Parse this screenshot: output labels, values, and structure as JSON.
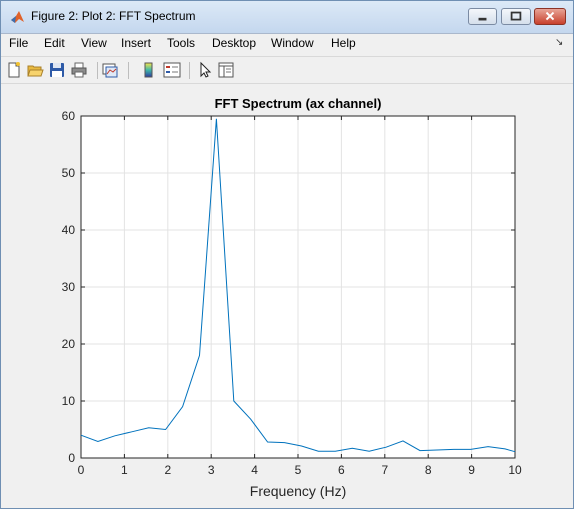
{
  "window": {
    "title": "Figure 2: Plot 2: FFT Spectrum"
  },
  "menu": {
    "items": [
      "File",
      "Edit",
      "View",
      "Insert",
      "Tools",
      "Desktop",
      "Window",
      "Help"
    ],
    "overflow_icon": "dock-arrow-icon"
  },
  "toolbar": {
    "icons": [
      "new-figure-icon",
      "open-file-icon",
      "save-icon",
      "print-icon",
      "link-plot-icon",
      "insert-colorbar-icon",
      "insert-legend-icon",
      "edit-plot-arrow-icon",
      "property-inspector-icon"
    ]
  },
  "chart_data": {
    "type": "line",
    "title": "FFT Spectrum (ax channel)",
    "xlabel": "Frequency (Hz)",
    "ylabel": "",
    "xlim": [
      0,
      10
    ],
    "ylim": [
      0,
      60
    ],
    "xticks": [
      0,
      1,
      2,
      3,
      4,
      5,
      6,
      7,
      8,
      9,
      10
    ],
    "yticks": [
      0,
      10,
      20,
      30,
      40,
      50,
      60
    ],
    "grid": true,
    "line_color": "#0072bd",
    "series": [
      {
        "x": [
          0,
          0.39,
          0.78,
          1.17,
          1.56,
          1.95,
          2.34,
          2.73,
          3.12,
          3.52,
          3.91,
          4.3,
          4.69,
          5.08,
          5.47,
          5.86,
          6.25,
          6.64,
          7.03,
          7.42,
          7.81,
          8.2,
          8.59,
          8.98,
          9.38,
          9.77,
          10
        ],
        "y": [
          4.0,
          2.9,
          3.9,
          4.6,
          5.3,
          5.0,
          9.0,
          18.0,
          59.5,
          10.0,
          6.8,
          2.8,
          2.7,
          2.1,
          1.2,
          1.2,
          1.7,
          1.2,
          1.9,
          3.0,
          1.3,
          1.4,
          1.5,
          1.5,
          2.0,
          1.6,
          1.1
        ]
      }
    ]
  }
}
